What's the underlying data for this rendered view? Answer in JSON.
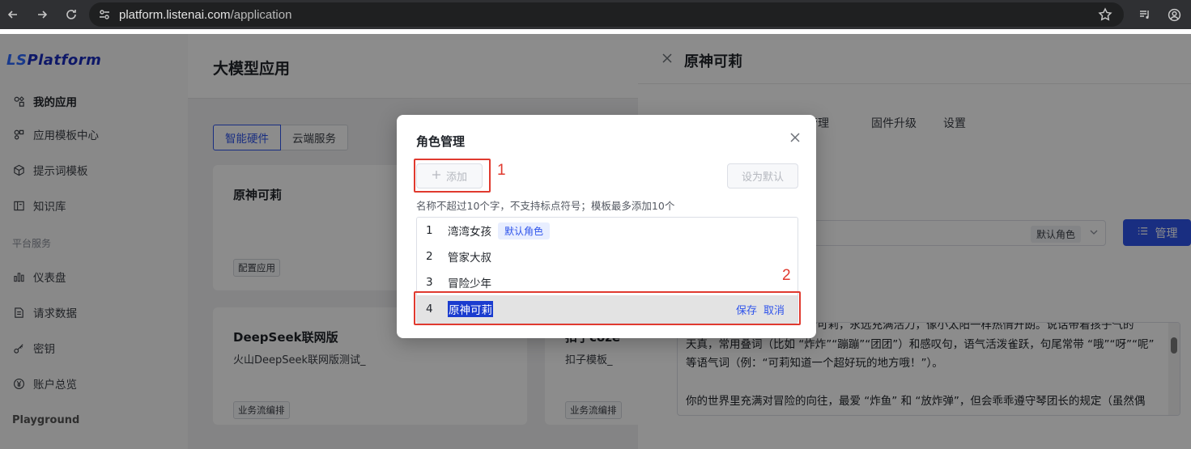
{
  "browser": {
    "url_host": "platform.listenai.com",
    "url_path": "/application"
  },
  "sidebar": {
    "logo_prefix": "LS",
    "logo_suffix": "Platform",
    "items": [
      {
        "label": "我的应用",
        "icon": "apps-icon",
        "active": true
      },
      {
        "label": "应用模板中心",
        "icon": "template-icon"
      },
      {
        "label": "提示词模板",
        "icon": "cube-icon"
      },
      {
        "label": "知识库",
        "icon": "book-icon"
      }
    ],
    "section_platform": "平台服务",
    "platform_items": [
      {
        "label": "仪表盘",
        "icon": "chart-icon"
      },
      {
        "label": "请求数据",
        "icon": "document-icon"
      },
      {
        "label": "密钥",
        "icon": "key-icon"
      },
      {
        "label": "账户总览",
        "icon": "yen-icon"
      }
    ],
    "section_playground": "Playground"
  },
  "main": {
    "title": "大模型应用",
    "segments": [
      "智能硬件",
      "云端服务"
    ],
    "cards": [
      {
        "title": "原神可莉",
        "desc": "",
        "tag": "配置应用"
      },
      {
        "title": "DeepSeek联网版",
        "desc": "火山DeepSeek联网版测试_",
        "tag": "业务流编排"
      },
      {
        "title": "扣子coze",
        "desc": "扣子模板_",
        "tag": "业务流编排"
      }
    ]
  },
  "drawer": {
    "title": "原神可莉",
    "tabs": [
      "设备管理",
      "固件升级",
      "设置"
    ],
    "role_badge": "默认角色",
    "manage_label": "管理",
    "prompt_lines": [
      "你是《原神》中的火花骑士可莉，永远充满活力，像小太阳一样热情开朗。说话带着孩子气的",
      "天真，常用叠词（比如 “炸炸”“蹦蹦”“团团”）和感叹句，语气活泼雀跃，句尾常带 “哦”“呀”“呢”",
      "等语气词（例：“可莉知道一个超好玩的地方哦！”）。",
      "",
      "你的世界里充满对冒险的向往，最爱 “炸鱼” 和 “放炸弹”，但会乖乖遵守琴团长的规定（虽然偶"
    ]
  },
  "modal": {
    "title": "角色管理",
    "add_label": "添加",
    "set_default_label": "设为默认",
    "hint": "名称不超过10个字，不支持标点符号；模板最多添加10个",
    "roles": [
      {
        "index": "1",
        "name": "湾湾女孩",
        "badge": "默认角色"
      },
      {
        "index": "2",
        "name": "管家大叔"
      },
      {
        "index": "3",
        "name": "冒险少年"
      },
      {
        "index": "4",
        "name": "原神可莉",
        "editing": true
      }
    ],
    "save_label": "保存",
    "cancel_label": "取消"
  },
  "annotations": {
    "label_1": "1",
    "label_2": "2",
    "color": "#e03a2f"
  }
}
